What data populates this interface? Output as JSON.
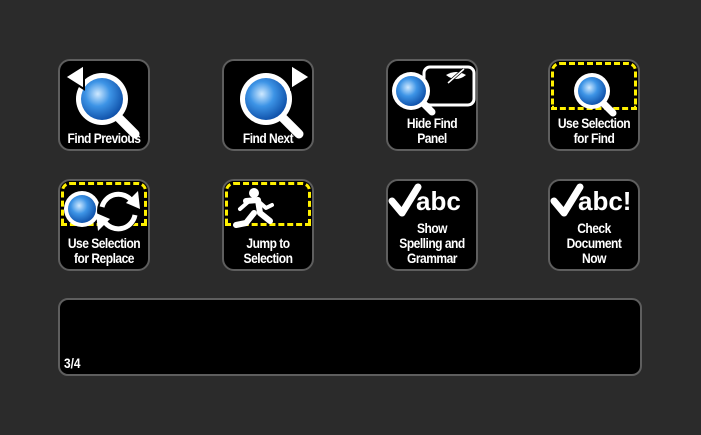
{
  "tiles": [
    {
      "name": "find-previous-button",
      "lines": [
        "Find Previous"
      ]
    },
    {
      "name": "find-next-button",
      "lines": [
        "Find Next"
      ]
    },
    {
      "name": "hide-find-panel-button",
      "lines": [
        "Hide Find",
        "Panel"
      ]
    },
    {
      "name": "use-selection-for-find-button",
      "lines": [
        "Use Selection",
        "for Find"
      ]
    },
    {
      "name": "use-selection-for-replace-button",
      "lines": [
        "Use Selection",
        "for Replace"
      ]
    },
    {
      "name": "jump-to-selection-button",
      "lines": [
        "Jump to",
        "Selection"
      ]
    },
    {
      "name": "show-spelling-and-grammar-button",
      "lines": [
        "Show",
        "Spelling and",
        "Grammar"
      ],
      "icon_text": "abc"
    },
    {
      "name": "check-document-now-button",
      "lines": [
        "Check",
        "Document",
        "Now"
      ],
      "icon_text": "abc!"
    }
  ],
  "panel": {
    "page_indicator": "3/4"
  },
  "colors": {
    "background": "#2b2b2b",
    "tile": "#000000",
    "border": "#5e5e5e",
    "highlight": "#fff000",
    "lens": "#3a8fe0"
  }
}
